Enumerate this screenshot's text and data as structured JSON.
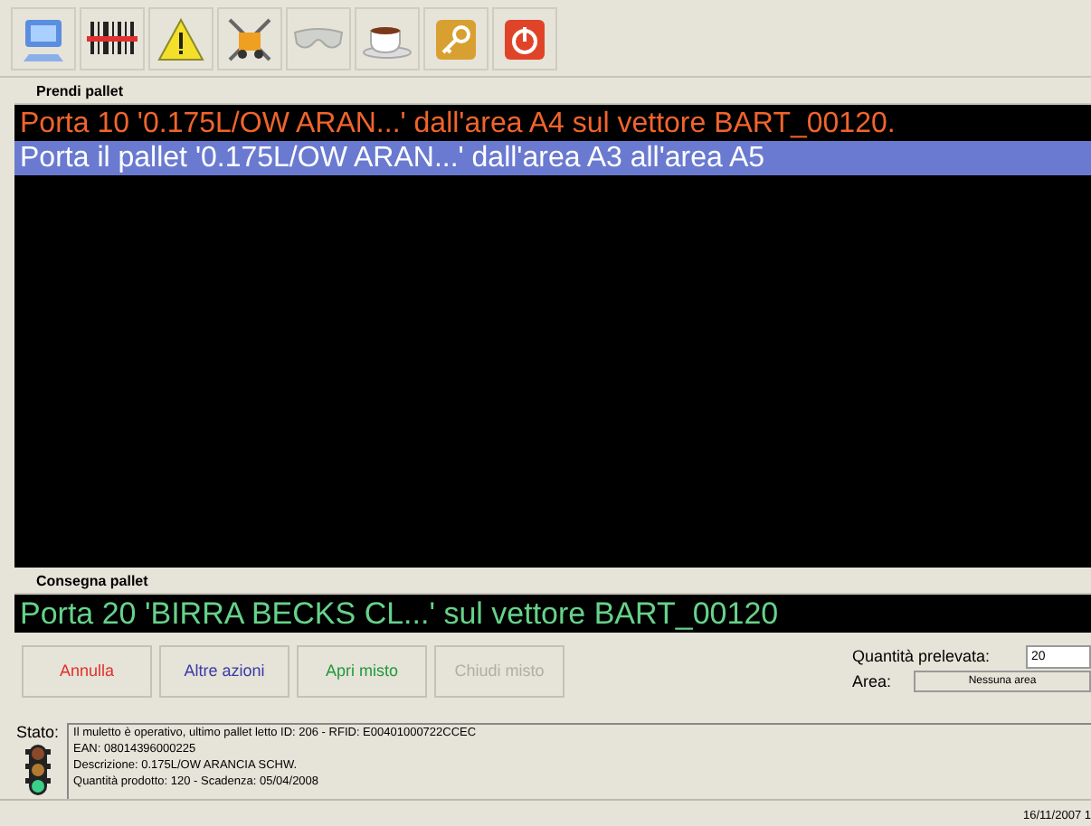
{
  "pick_section": {
    "title": "Prendi pallet",
    "rows": [
      {
        "text": "Porta 10 '0.175L/OW ARAN...' dall'area A4 sul vettore BART_00120.",
        "selected": false
      },
      {
        "text": "Porta il pallet '0.175L/OW ARAN...' dall'area A3 all'area A5",
        "selected": true
      }
    ]
  },
  "deliver_section": {
    "title": "Consegna pallet",
    "text": "Porta 20 'BIRRA BECKS CL...' sul vettore BART_00120"
  },
  "buttons": [
    {
      "label": "Annulla",
      "color": "#e0302a",
      "disabled": false
    },
    {
      "label": "Altre azioni",
      "color": "#3a3aa8",
      "disabled": false
    },
    {
      "label": "Apri misto",
      "color": "#1f9a3a",
      "disabled": false
    },
    {
      "label": "Chiudi misto",
      "disabled": true
    }
  ],
  "quantity": {
    "label": "Quantità prelevata:",
    "value": "20"
  },
  "area": {
    "label": "Area:",
    "value": "Nessuna area"
  },
  "status": {
    "label": "Stato:",
    "lines": [
      "Il muletto è operativo, ultimo pallet letto ID: 206 - RFID: E00401000722CCEC",
      "EAN: 08014396000225",
      "Descrizione: 0.175L/OW ARANCIA SCHW.",
      "Quantità prodotto: 120 - Scadenza: 05/04/2008"
    ]
  },
  "status_bar": {
    "datetime": "16/11/2007 1"
  }
}
